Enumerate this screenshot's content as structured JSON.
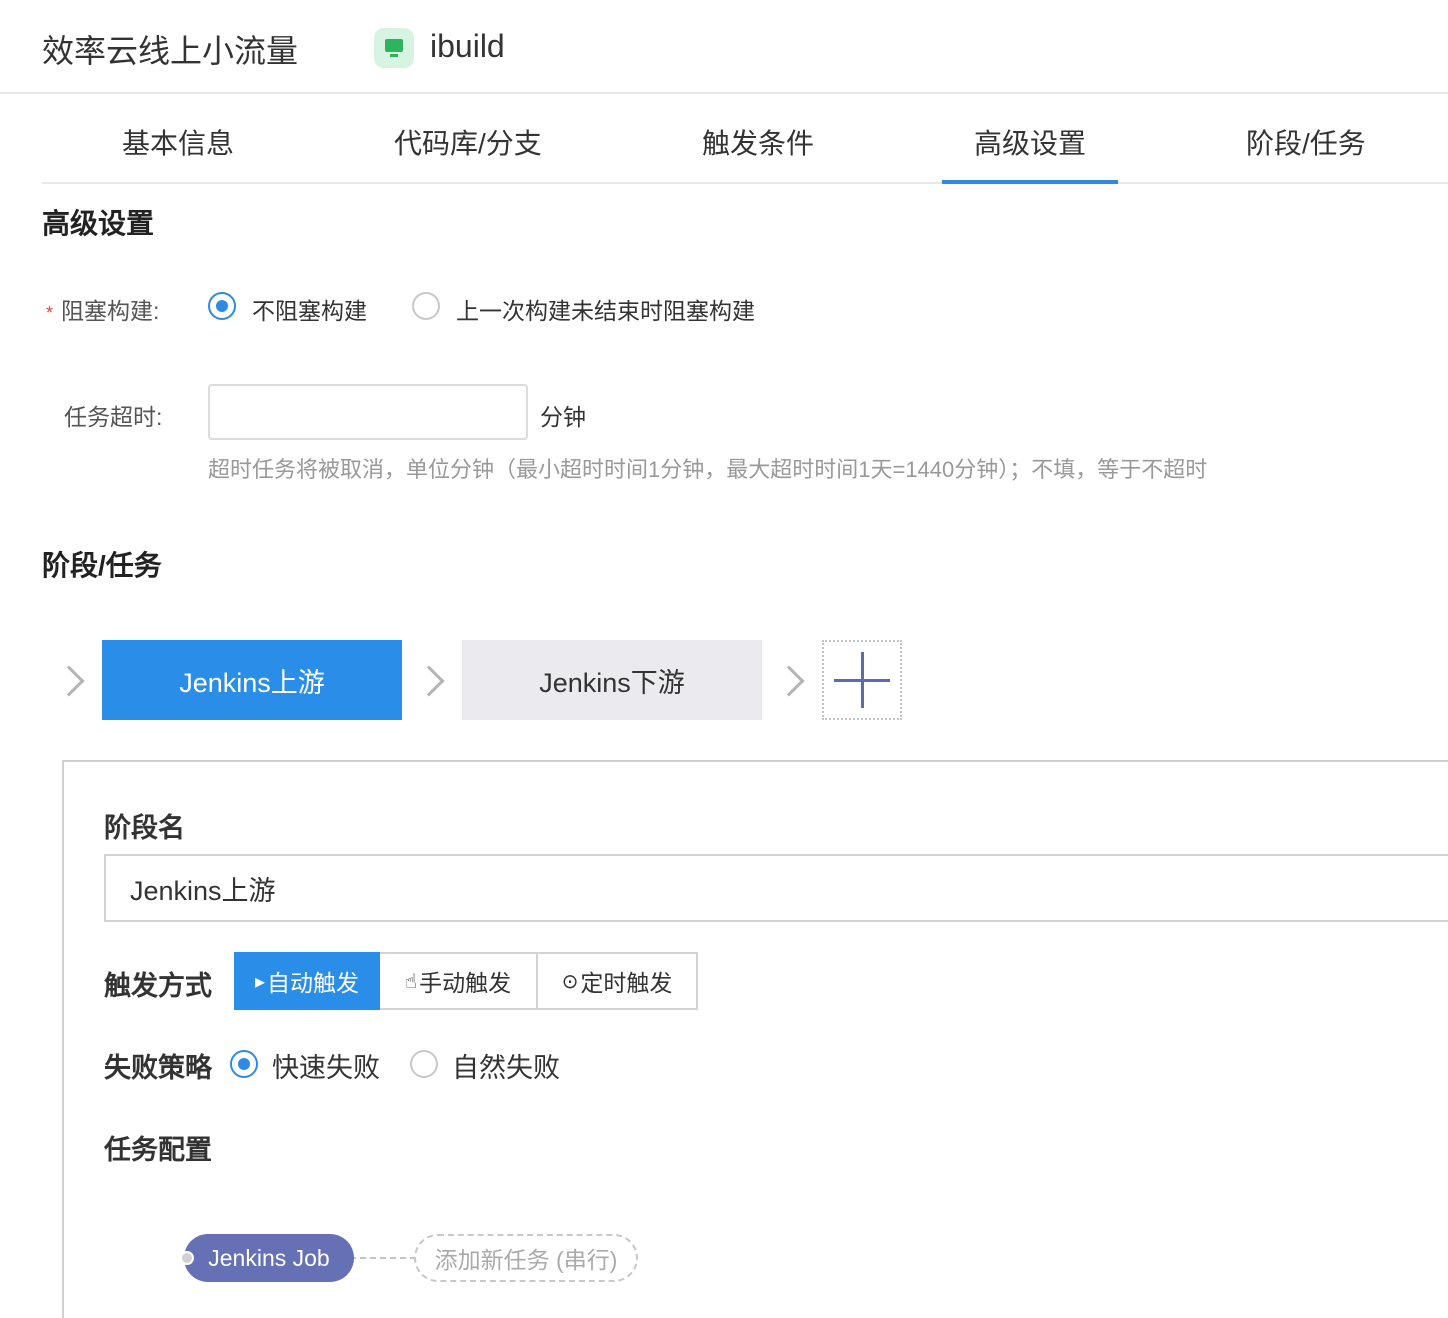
{
  "header": {
    "title": "效率云线上小流量",
    "app_name": "ibuild",
    "app_icon": "monitor-icon"
  },
  "tabs": [
    {
      "label": "基本信息"
    },
    {
      "label": "代码库/分支"
    },
    {
      "label": "触发条件"
    },
    {
      "label": "高级设置",
      "active": true
    },
    {
      "label": "阶段/任务"
    }
  ],
  "advanced": {
    "title": "高级设置",
    "block_build": {
      "required_mark": "*",
      "label": "阻塞构建:",
      "options": [
        "不阻塞构建",
        "上一次构建未结束时阻塞构建"
      ],
      "selected": "不阻塞构建"
    },
    "timeout": {
      "label": "任务超时:",
      "value": "",
      "unit": "分钟",
      "hint": "超时任务将被取消，单位分钟（最小超时时间1分钟，最大超时时间1天=1440分钟）；不填，等于不超时"
    }
  },
  "stages_section": {
    "title": "阶段/任务",
    "stages": [
      "Jenkins上游",
      "Jenkins下游"
    ],
    "active_stage": "Jenkins上游",
    "add_icon": "plus-icon"
  },
  "stage_panel": {
    "name_label": "阶段名",
    "name_value": "Jenkins上游",
    "trigger_label": "触发方式",
    "trigger_options": [
      {
        "icon": "▸",
        "icon_name": "play-icon",
        "label": "自动触发",
        "active": true
      },
      {
        "icon": "☝",
        "icon_name": "hand-pointer-icon",
        "label": "手动触发"
      },
      {
        "icon": "⊙",
        "icon_name": "clock-icon",
        "label": "定时触发"
      }
    ],
    "failure_label": "失败策略",
    "failure_options": [
      "快速失败",
      "自然失败"
    ],
    "failure_selected": "快速失败",
    "task_label": "任务配置",
    "task": "Jenkins Job",
    "add_task": "添加新任务 (串行)"
  },
  "colors": {
    "accent": "#2a8ee9",
    "job_pill": "#6670b4",
    "required": "#e64340",
    "hint": "#999999"
  }
}
